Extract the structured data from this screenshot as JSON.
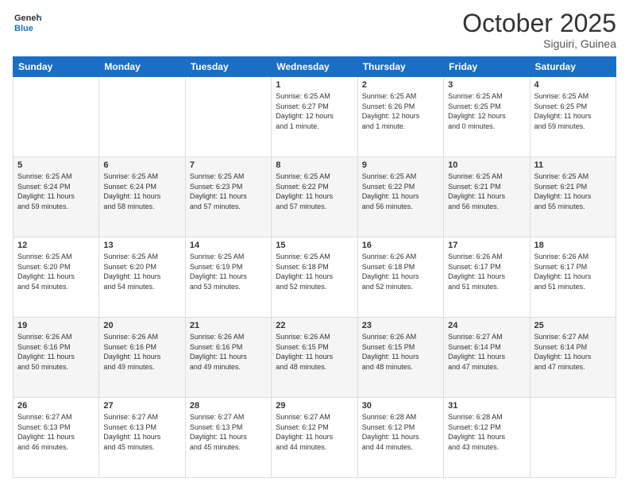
{
  "logo": {
    "general": "General",
    "blue": "Blue"
  },
  "title": "October 2025",
  "location": "Siguiri, Guinea",
  "days_header": [
    "Sunday",
    "Monday",
    "Tuesday",
    "Wednesday",
    "Thursday",
    "Friday",
    "Saturday"
  ],
  "weeks": [
    [
      {
        "day": "",
        "info": ""
      },
      {
        "day": "",
        "info": ""
      },
      {
        "day": "",
        "info": ""
      },
      {
        "day": "1",
        "info": "Sunrise: 6:25 AM\nSunset: 6:27 PM\nDaylight: 12 hours\nand 1 minute."
      },
      {
        "day": "2",
        "info": "Sunrise: 6:25 AM\nSunset: 6:26 PM\nDaylight: 12 hours\nand 1 minute."
      },
      {
        "day": "3",
        "info": "Sunrise: 6:25 AM\nSunset: 6:25 PM\nDaylight: 12 hours\nand 0 minutes."
      },
      {
        "day": "4",
        "info": "Sunrise: 6:25 AM\nSunset: 6:25 PM\nDaylight: 11 hours\nand 59 minutes."
      }
    ],
    [
      {
        "day": "5",
        "info": "Sunrise: 6:25 AM\nSunset: 6:24 PM\nDaylight: 11 hours\nand 59 minutes."
      },
      {
        "day": "6",
        "info": "Sunrise: 6:25 AM\nSunset: 6:24 PM\nDaylight: 11 hours\nand 58 minutes."
      },
      {
        "day": "7",
        "info": "Sunrise: 6:25 AM\nSunset: 6:23 PM\nDaylight: 11 hours\nand 57 minutes."
      },
      {
        "day": "8",
        "info": "Sunrise: 6:25 AM\nSunset: 6:22 PM\nDaylight: 11 hours\nand 57 minutes."
      },
      {
        "day": "9",
        "info": "Sunrise: 6:25 AM\nSunset: 6:22 PM\nDaylight: 11 hours\nand 56 minutes."
      },
      {
        "day": "10",
        "info": "Sunrise: 6:25 AM\nSunset: 6:21 PM\nDaylight: 11 hours\nand 56 minutes."
      },
      {
        "day": "11",
        "info": "Sunrise: 6:25 AM\nSunset: 6:21 PM\nDaylight: 11 hours\nand 55 minutes."
      }
    ],
    [
      {
        "day": "12",
        "info": "Sunrise: 6:25 AM\nSunset: 6:20 PM\nDaylight: 11 hours\nand 54 minutes."
      },
      {
        "day": "13",
        "info": "Sunrise: 6:25 AM\nSunset: 6:20 PM\nDaylight: 11 hours\nand 54 minutes."
      },
      {
        "day": "14",
        "info": "Sunrise: 6:25 AM\nSunset: 6:19 PM\nDaylight: 11 hours\nand 53 minutes."
      },
      {
        "day": "15",
        "info": "Sunrise: 6:25 AM\nSunset: 6:18 PM\nDaylight: 11 hours\nand 52 minutes."
      },
      {
        "day": "16",
        "info": "Sunrise: 6:26 AM\nSunset: 6:18 PM\nDaylight: 11 hours\nand 52 minutes."
      },
      {
        "day": "17",
        "info": "Sunrise: 6:26 AM\nSunset: 6:17 PM\nDaylight: 11 hours\nand 51 minutes."
      },
      {
        "day": "18",
        "info": "Sunrise: 6:26 AM\nSunset: 6:17 PM\nDaylight: 11 hours\nand 51 minutes."
      }
    ],
    [
      {
        "day": "19",
        "info": "Sunrise: 6:26 AM\nSunset: 6:16 PM\nDaylight: 11 hours\nand 50 minutes."
      },
      {
        "day": "20",
        "info": "Sunrise: 6:26 AM\nSunset: 6:16 PM\nDaylight: 11 hours\nand 49 minutes."
      },
      {
        "day": "21",
        "info": "Sunrise: 6:26 AM\nSunset: 6:16 PM\nDaylight: 11 hours\nand 49 minutes."
      },
      {
        "day": "22",
        "info": "Sunrise: 6:26 AM\nSunset: 6:15 PM\nDaylight: 11 hours\nand 48 minutes."
      },
      {
        "day": "23",
        "info": "Sunrise: 6:26 AM\nSunset: 6:15 PM\nDaylight: 11 hours\nand 48 minutes."
      },
      {
        "day": "24",
        "info": "Sunrise: 6:27 AM\nSunset: 6:14 PM\nDaylight: 11 hours\nand 47 minutes."
      },
      {
        "day": "25",
        "info": "Sunrise: 6:27 AM\nSunset: 6:14 PM\nDaylight: 11 hours\nand 47 minutes."
      }
    ],
    [
      {
        "day": "26",
        "info": "Sunrise: 6:27 AM\nSunset: 6:13 PM\nDaylight: 11 hours\nand 46 minutes."
      },
      {
        "day": "27",
        "info": "Sunrise: 6:27 AM\nSunset: 6:13 PM\nDaylight: 11 hours\nand 45 minutes."
      },
      {
        "day": "28",
        "info": "Sunrise: 6:27 AM\nSunset: 6:13 PM\nDaylight: 11 hours\nand 45 minutes."
      },
      {
        "day": "29",
        "info": "Sunrise: 6:27 AM\nSunset: 6:12 PM\nDaylight: 11 hours\nand 44 minutes."
      },
      {
        "day": "30",
        "info": "Sunrise: 6:28 AM\nSunset: 6:12 PM\nDaylight: 11 hours\nand 44 minutes."
      },
      {
        "day": "31",
        "info": "Sunrise: 6:28 AM\nSunset: 6:12 PM\nDaylight: 11 hours\nand 43 minutes."
      },
      {
        "day": "",
        "info": ""
      }
    ]
  ]
}
